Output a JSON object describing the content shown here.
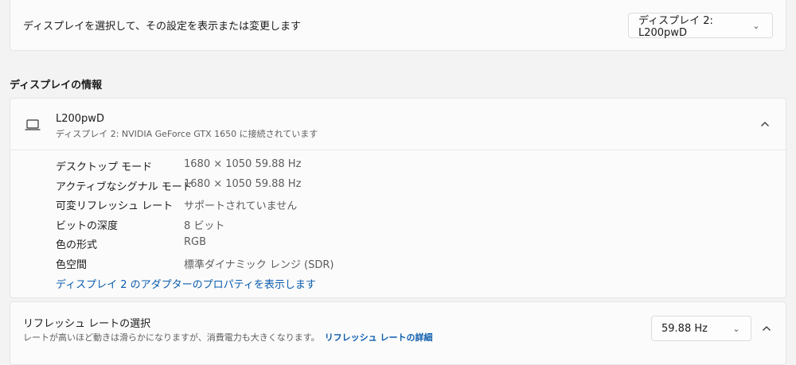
{
  "display_select": {
    "label": "ディスプレイを選択して、その設定を表示または変更します",
    "selected": "ディスプレイ 2: L200pwD"
  },
  "info_section": {
    "title": "ディスプレイの情報",
    "monitor_name": "L200pwD",
    "monitor_sub": "ディスプレイ 2: NVIDIA GeForce GTX 1650 に接続されています",
    "rows": [
      {
        "key": "デスクトップ モード",
        "value": "1680 × 1050 59.88 Hz"
      },
      {
        "key": "アクティブなシグナル モード",
        "value": "1680 × 1050 59.88 Hz"
      },
      {
        "key": "可変リフレッシュ レート",
        "value": "サポートされていません"
      },
      {
        "key": "ビットの深度",
        "value": "8 ビット"
      },
      {
        "key": "色の形式",
        "value": "RGB"
      },
      {
        "key": "色空間",
        "value": "標準ダイナミック レンジ (SDR)"
      }
    ],
    "adapter_link": "ディスプレイ 2 のアダプターのプロパティを表示します"
  },
  "refresh": {
    "title": "リフレッシュ レートの選択",
    "subtitle": "レートが高いほど動きは滑らかになりますが、消費電力も大きくなります。",
    "link": "リフレッシュ レートの詳細",
    "selected": "59.88 Hz"
  },
  "icons": {
    "dropdown": "chevron-down-icon",
    "collapse": "chevron-up-icon",
    "monitor": "laptop-icon"
  },
  "colors": {
    "link": "#0b5cad",
    "background": "#f3f3f3",
    "card": "#fbfbfb"
  }
}
